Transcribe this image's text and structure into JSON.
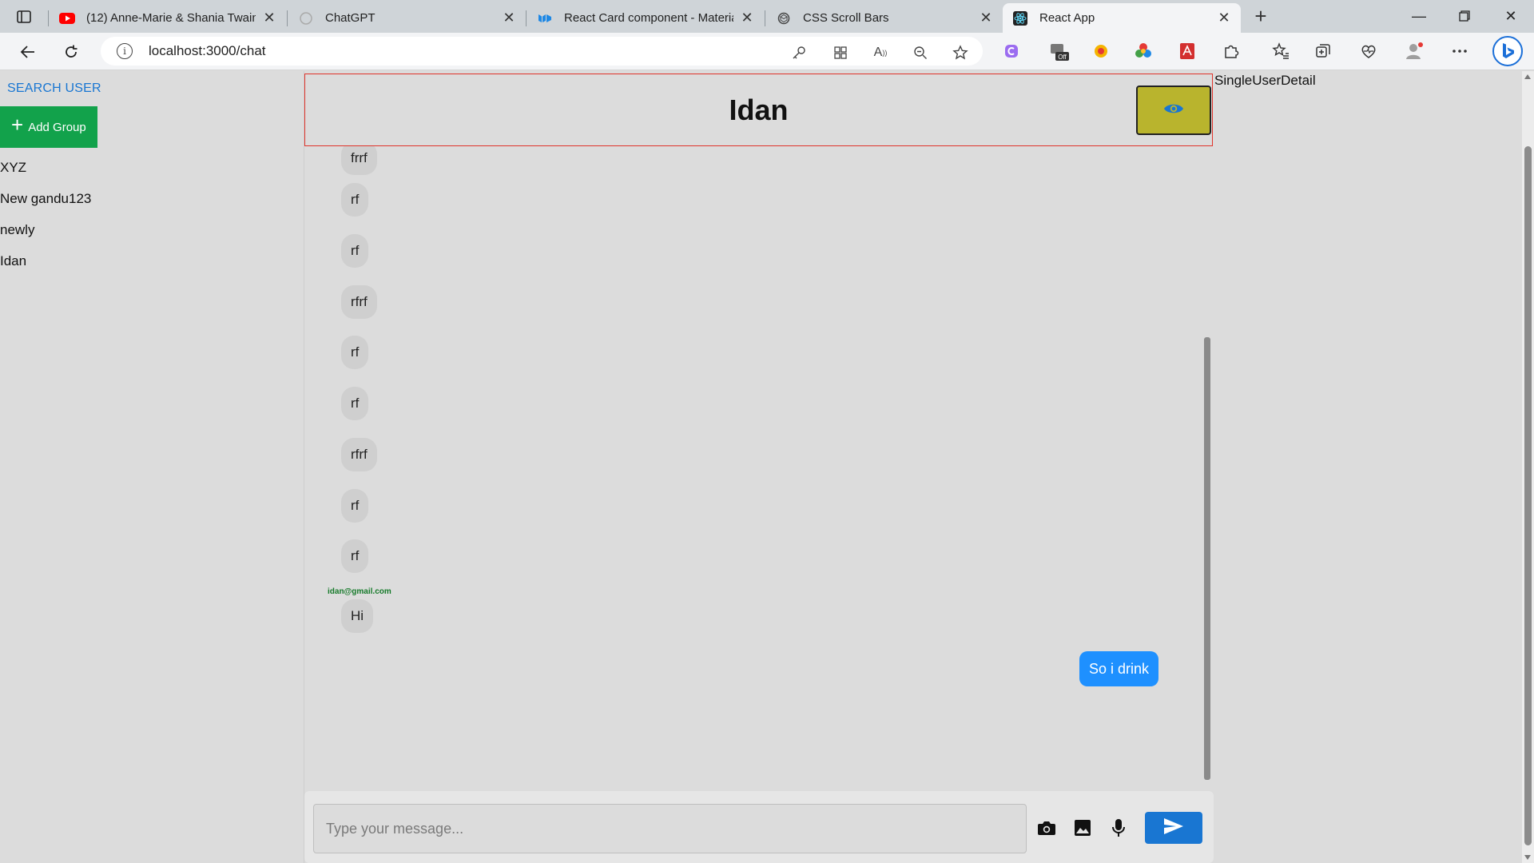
{
  "browser": {
    "tabs": [
      {
        "label": "(12) Anne-Marie & Shania Twain",
        "icon": "youtube-icon",
        "active": false
      },
      {
        "label": "ChatGPT",
        "icon": "chatgpt-icon",
        "active": false
      },
      {
        "label": "React Card component - Materia",
        "icon": "mui-icon",
        "active": false
      },
      {
        "label": "CSS Scroll Bars",
        "icon": "codepen-icon",
        "active": false
      },
      {
        "label": "React App",
        "icon": "react-icon",
        "active": true
      }
    ],
    "url": "localhost:3000/chat",
    "extension_badge": "Off"
  },
  "sidebar": {
    "search_label": "SEARCH USER",
    "add_group_label": "Add Group",
    "chats": [
      "XYZ",
      "New gandu123",
      "newly",
      "Idan"
    ]
  },
  "chat": {
    "title": "Idan",
    "messages": [
      {
        "text": "frrf"
      },
      {
        "text": "rf"
      },
      {
        "text": "rf"
      },
      {
        "text": "rfrf"
      },
      {
        "text": "rf"
      },
      {
        "text": "rf"
      },
      {
        "text": "rfrf"
      },
      {
        "text": "rf"
      },
      {
        "text": "rf"
      },
      {
        "text": "Hi",
        "sender": "idan@gmail.com"
      },
      {
        "text": "So i drink",
        "outgoing": true
      }
    ],
    "input_placeholder": "Type your message...",
    "input_value": ""
  },
  "details": {
    "title": "SingleUserDetail"
  },
  "colors": {
    "accent": "#1976d2",
    "add_group": "#12a24b",
    "header_border": "#e0342b",
    "eye_button": "#b9b42d",
    "outgoing_bubble": "#1e90ff",
    "incoming_bubble": "#cfcfcf",
    "sender_email": "#167a2a"
  }
}
